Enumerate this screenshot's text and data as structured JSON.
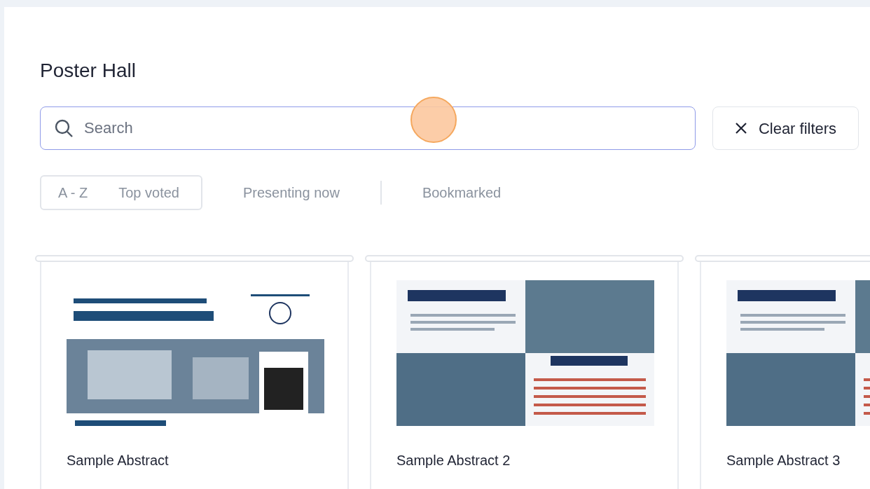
{
  "page": {
    "title": "Poster Hall"
  },
  "search": {
    "placeholder": "Search"
  },
  "clear_filters": {
    "label": "Clear filters"
  },
  "sort_options": [
    {
      "label": "A - Z"
    },
    {
      "label": "Top voted"
    }
  ],
  "filters": [
    {
      "label": "Presenting now"
    },
    {
      "label": "Bookmarked"
    }
  ],
  "posters": [
    {
      "title": "Sample Abstract",
      "kind": "call"
    },
    {
      "title": "Sample Abstract 2",
      "kind": "mission"
    },
    {
      "title": "Sample Abstract 3",
      "kind": "mission"
    }
  ]
}
